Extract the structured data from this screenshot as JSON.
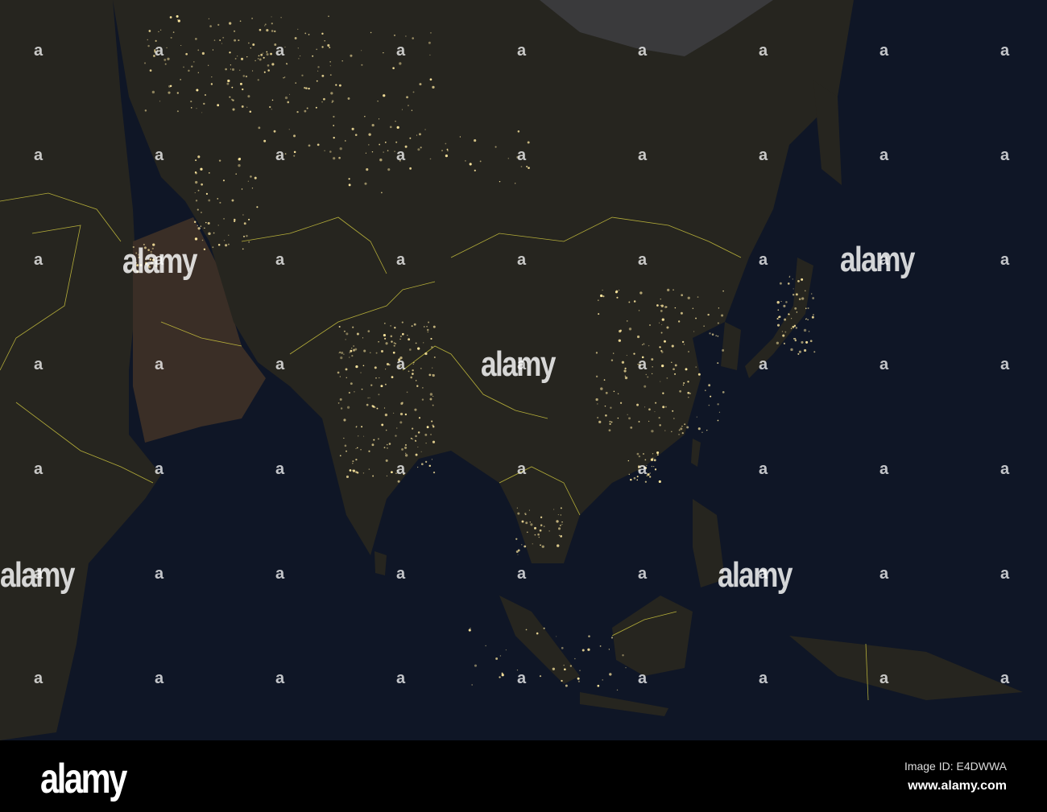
{
  "watermark": {
    "logo_text": "alamy",
    "small_mark": "a"
  },
  "footer": {
    "logo": "alamy",
    "image_id": "Image ID: E4DWWA",
    "url": "www.alamy.com"
  },
  "colors": {
    "ocean": "#0f1626",
    "land": "#26251f",
    "borders": "#d8d040",
    "lights": "#ffe9a0"
  }
}
